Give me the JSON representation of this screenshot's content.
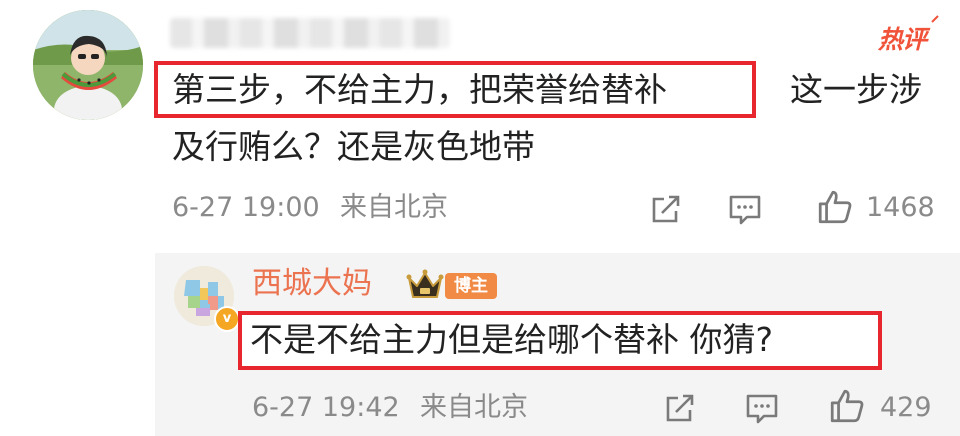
{
  "main_comment": {
    "hot_label": "热评",
    "line1_highlight": "第三步，不给主力，把荣誉给替补",
    "line1_tail": "这一步涉",
    "line2": "及行贿么？还是灰色地带",
    "timestamp": "6-27 19:00",
    "source": "来自北京",
    "like_count": "1468"
  },
  "reply": {
    "username": "西城大妈",
    "tag": "博主",
    "text": "不是不给主力但是给哪个替补 你猜?",
    "timestamp": "6-27 19:42",
    "source": "来自北京",
    "like_count": "429"
  },
  "colors": {
    "highlight_border": "#e8262e",
    "username": "#eb7350",
    "hot": "#f0533a",
    "meta": "#8a8a8a"
  },
  "icons": [
    "share-icon",
    "comment-icon",
    "like-icon",
    "crown-icon",
    "verified-icon"
  ]
}
